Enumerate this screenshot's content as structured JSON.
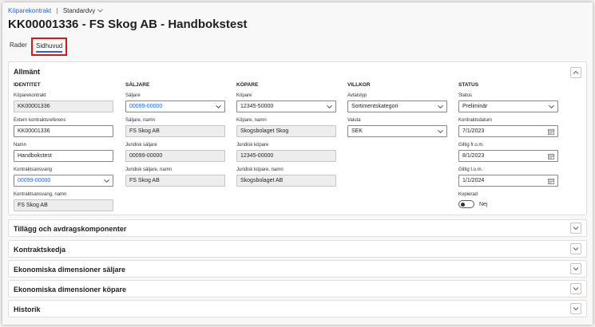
{
  "breadcrumb": {
    "form": "Köparekontrakt",
    "view": "Standardvy"
  },
  "page_title": "KK00001336 - FS Skog AB - Handbokstest",
  "tabs": {
    "lines": "Rader",
    "header": "Sidhuvud"
  },
  "general": {
    "title": "Allmänt",
    "identity": {
      "heading": "IDENTITET",
      "contract_label": "Köparekontrakt",
      "contract_value": "KK00001336",
      "ext_ref_label": "Extern kontraktsreferens",
      "ext_ref_value": "KK00001336",
      "name_label": "Namn",
      "name_value": "Handbokstest",
      "responsible_label": "Kontraktsansvarig",
      "responsible_value": "00099-00000",
      "responsible_name_label": "Kontraktsansvarig, namn",
      "responsible_name_value": "FS Skog AB"
    },
    "seller": {
      "heading": "SÄLJARE",
      "seller_label": "Säljare",
      "seller_value": "00099-00000",
      "seller_name_label": "Säljare, namn",
      "seller_name_value": "FS Skog AB",
      "legal_seller_label": "Juridisk säljare",
      "legal_seller_value": "00099-00000",
      "legal_seller_name_label": "Juridisk säljare, namn",
      "legal_seller_name_value": "FS Skog AB"
    },
    "buyer": {
      "heading": "KÖPARE",
      "buyer_label": "Köpare",
      "buyer_value": "12345-50000",
      "buyer_name_label": "Köpare, namn",
      "buyer_name_value": "Skogsbolaget Skog",
      "legal_buyer_label": "Juridisk köpare",
      "legal_buyer_value": "12345-00000",
      "legal_buyer_name_label": "Juridisk köpare, namn",
      "legal_buyer_name_value": "Skogsbolaget AB"
    },
    "terms": {
      "heading": "VILLKOR",
      "agreement_type_label": "Avtalstyp",
      "agreement_type_value": "Sortimentskategori",
      "currency_label": "Valuta",
      "currency_value": "SEK"
    },
    "status": {
      "heading": "STATUS",
      "status_label": "Status",
      "status_value": "Preliminär",
      "contract_date_label": "Kontraktsdatum",
      "contract_date_value": "7/1/2023",
      "valid_from_label": "Giltig fr.o.m.",
      "valid_from_value": "8/1/2023",
      "valid_to_label": "Giltig t.o.m.",
      "valid_to_value": "1/1/2024",
      "copied_label": "Kopierad",
      "copied_value": "Nej"
    }
  },
  "sections": {
    "additions": "Tillägg och avdragskomponenter",
    "chain": "Kontraktskedja",
    "fin_dim_seller": "Ekonomiska dimensioner säljare",
    "fin_dim_buyer": "Ekonomiska dimensioner köpare",
    "history": "Historik"
  },
  "icons": {
    "expand": "chevron-down-icon",
    "collapse": "chevron-up-icon",
    "dropdown": "chevron-down-icon",
    "calendar": "calendar-icon"
  },
  "colors": {
    "link": "#2266e3",
    "highlight": "#d11a1a"
  }
}
